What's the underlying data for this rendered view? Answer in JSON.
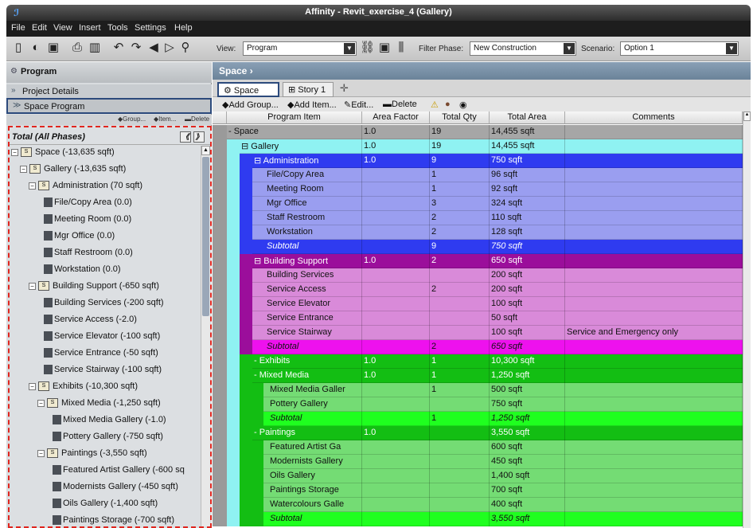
{
  "window": {
    "title": "Affinity - Revit_exercise_4 (Gallery)"
  },
  "menu": [
    "File",
    "Edit",
    "View",
    "Insert",
    "Tools",
    "Settings",
    "Help"
  ],
  "toolbar": {
    "view_label": "View:",
    "view_value": "Program",
    "filter_label": "Filter Phase:",
    "filter_value": "New Construction",
    "scenario_label": "Scenario:",
    "scenario_value": "Option 1"
  },
  "left": {
    "header": "Program",
    "project_details": "Project Details",
    "space_program": "Space Program",
    "actions": [
      "Group...",
      "Item...",
      "Delete"
    ],
    "tree_title": "Total (All Phases)",
    "tree": [
      {
        "label": "Space (-13,635 sqft)",
        "level": 0,
        "type": "folder"
      },
      {
        "label": "Gallery (-13,635 sqft)",
        "level": 1,
        "type": "folder"
      },
      {
        "label": "Administration (70 sqft)",
        "level": 2,
        "type": "folder"
      },
      {
        "label": "File/Copy Area  (0.0)",
        "level": 3,
        "type": "leaf"
      },
      {
        "label": "Meeting Room  (0.0)",
        "level": 3,
        "type": "leaf"
      },
      {
        "label": "Mgr Office  (0.0)",
        "level": 3,
        "type": "leaf"
      },
      {
        "label": "Staff Restroom  (0.0)",
        "level": 3,
        "type": "leaf"
      },
      {
        "label": "Workstation  (0.0)",
        "level": 3,
        "type": "leaf"
      },
      {
        "label": "Building Support (-650 sqft)",
        "level": 2,
        "type": "folder"
      },
      {
        "label": "Building Services  (-200 sqft)",
        "level": 3,
        "type": "leaf"
      },
      {
        "label": "Service Access  (-2.0)",
        "level": 3,
        "type": "leaf"
      },
      {
        "label": "Service Elevator  (-100 sqft)",
        "level": 3,
        "type": "leaf"
      },
      {
        "label": "Service Entrance  (-50 sqft)",
        "level": 3,
        "type": "leaf"
      },
      {
        "label": "Service Stairway  (-100 sqft)",
        "level": 3,
        "type": "leaf"
      },
      {
        "label": "Exhibits (-10,300 sqft)",
        "level": 2,
        "type": "folder"
      },
      {
        "label": "Mixed Media (-1,250 sqft)",
        "level": 3,
        "type": "folder"
      },
      {
        "label": "Mixed Media Gallery  (-1.0)",
        "level": 4,
        "type": "leaf"
      },
      {
        "label": "Pottery Gallery  (-750 sqft)",
        "level": 4,
        "type": "leaf"
      },
      {
        "label": "Paintings (-3,550 sqft)",
        "level": 3,
        "type": "folder"
      },
      {
        "label": "Featured Artist Gallery  (-600 sq",
        "level": 4,
        "type": "leaf"
      },
      {
        "label": "Modernists Gallery  (-450 sqft)",
        "level": 4,
        "type": "leaf"
      },
      {
        "label": "Oils Gallery  (-1,400 sqft)",
        "level": 4,
        "type": "leaf"
      },
      {
        "label": "Paintings Storage  (-700 sqft)",
        "level": 4,
        "type": "leaf"
      }
    ]
  },
  "right": {
    "breadcrumb": "Space ›",
    "tabs": [
      "Space",
      "Story 1"
    ],
    "actions": [
      "Add Group...",
      "Add Item...",
      "Edit...",
      "Delete"
    ],
    "columns": [
      "Program Item",
      "Area Factor",
      "Total Qty",
      "Total Area",
      "Comments"
    ],
    "colors": {
      "space": "#a6a6a6",
      "gallery": "#8ff2f2",
      "admin_head": "#2f3bf0",
      "admin_row": "#9a9ef0",
      "support_head": "#9b0e9b",
      "support_row": "#d98ad9",
      "support_sub": "#ee11ee",
      "exhibit_head": "#13be13",
      "exhibit_row": "#74dc74",
      "exhibit_sub": "#1fff1f"
    },
    "rows": [
      {
        "item": "Space",
        "area": "1.0",
        "qty": "19",
        "total": "14,455 sqft",
        "comments": "",
        "kind": "space",
        "depth": 0,
        "exp": "-"
      },
      {
        "item": "Gallery",
        "area": "1.0",
        "qty": "19",
        "total": "14,455 sqft",
        "comments": "",
        "kind": "gallery",
        "depth": 1,
        "exp": "⊟"
      },
      {
        "item": "Administration",
        "area": "1.0",
        "qty": "9",
        "total": "750 sqft",
        "comments": "",
        "kind": "admin_head",
        "depth": 2,
        "exp": "⊟"
      },
      {
        "item": "File/Copy Area",
        "area": "",
        "qty": "1",
        "total": "96 sqft",
        "comments": "",
        "kind": "admin_row",
        "depth": 3
      },
      {
        "item": "Meeting Room",
        "area": "",
        "qty": "1",
        "total": "92 sqft",
        "comments": "",
        "kind": "admin_row",
        "depth": 3
      },
      {
        "item": "Mgr Office",
        "area": "",
        "qty": "3",
        "total": "324 sqft",
        "comments": "",
        "kind": "admin_row",
        "depth": 3
      },
      {
        "item": "Staff Restroom",
        "area": "",
        "qty": "2",
        "total": "110 sqft",
        "comments": "",
        "kind": "admin_row",
        "depth": 3
      },
      {
        "item": "Workstation",
        "area": "",
        "qty": "2",
        "total": "128 sqft",
        "comments": "",
        "kind": "admin_row",
        "depth": 3
      },
      {
        "item": "Subtotal",
        "area": "",
        "qty": "9",
        "total": "750 sqft",
        "comments": "",
        "kind": "admin_sub",
        "depth": 3,
        "italic": true
      },
      {
        "item": "Building Support",
        "area": "1.0",
        "qty": "2",
        "total": "650 sqft",
        "comments": "",
        "kind": "support_head",
        "depth": 2,
        "exp": "⊟"
      },
      {
        "item": "Building Services",
        "area": "",
        "qty": "",
        "total": "200 sqft",
        "comments": "",
        "kind": "support_row",
        "depth": 3
      },
      {
        "item": "Service Access",
        "area": "",
        "qty": "2",
        "total": "200 sqft",
        "comments": "",
        "kind": "support_row",
        "depth": 3
      },
      {
        "item": "Service Elevator",
        "area": "",
        "qty": "",
        "total": "100 sqft",
        "comments": "",
        "kind": "support_row",
        "depth": 3
      },
      {
        "item": "Service Entrance",
        "area": "",
        "qty": "",
        "total": "50 sqft",
        "comments": "",
        "kind": "support_row",
        "depth": 3
      },
      {
        "item": "Service Stairway",
        "area": "",
        "qty": "",
        "total": "100 sqft",
        "comments": "Service and Emergency only",
        "kind": "support_row",
        "depth": 3
      },
      {
        "item": "Subtotal",
        "area": "",
        "qty": "2",
        "total": "650 sqft",
        "comments": "",
        "kind": "support_sub",
        "depth": 3,
        "italic": true
      },
      {
        "item": "Exhibits",
        "area": "1.0",
        "qty": "1",
        "total": "10,300 sqft",
        "comments": "",
        "kind": "exhibit_head",
        "depth": 2,
        "exp": "-"
      },
      {
        "item": "Mixed Media",
        "area": "1.0",
        "qty": "1",
        "total": "1,250 sqft",
        "comments": "",
        "kind": "exhibit_head",
        "depth": 3,
        "exp": "-"
      },
      {
        "item": "Mixed Media Galler",
        "area": "",
        "qty": "1",
        "total": "500 sqft",
        "comments": "",
        "kind": "exhibit_row",
        "depth": 4
      },
      {
        "item": "Pottery Gallery",
        "area": "",
        "qty": "",
        "total": "750 sqft",
        "comments": "",
        "kind": "exhibit_row",
        "depth": 4
      },
      {
        "item": "Subtotal",
        "area": "",
        "qty": "1",
        "total": "1,250 sqft",
        "comments": "",
        "kind": "exhibit_sub",
        "depth": 4,
        "italic": true
      },
      {
        "item": "Paintings",
        "area": "1.0",
        "qty": "",
        "total": "3,550 sqft",
        "comments": "",
        "kind": "exhibit_head",
        "depth": 3,
        "exp": "-"
      },
      {
        "item": "Featured Artist Ga",
        "area": "",
        "qty": "",
        "total": "600 sqft",
        "comments": "",
        "kind": "exhibit_row",
        "depth": 4
      },
      {
        "item": "Modernists Gallery",
        "area": "",
        "qty": "",
        "total": "450 sqft",
        "comments": "",
        "kind": "exhibit_row",
        "depth": 4
      },
      {
        "item": "Oils Gallery",
        "area": "",
        "qty": "",
        "total": "1,400 sqft",
        "comments": "",
        "kind": "exhibit_row",
        "depth": 4
      },
      {
        "item": "Paintings Storage",
        "area": "",
        "qty": "",
        "total": "700 sqft",
        "comments": "",
        "kind": "exhibit_row",
        "depth": 4
      },
      {
        "item": "Watercolours Galle",
        "area": "",
        "qty": "",
        "total": "400 sqft",
        "comments": "",
        "kind": "exhibit_row",
        "depth": 4
      },
      {
        "item": "Subtotal",
        "area": "",
        "qty": "",
        "total": "3,550 sqft",
        "comments": "",
        "kind": "exhibit_sub",
        "depth": 4,
        "italic": true
      }
    ]
  }
}
